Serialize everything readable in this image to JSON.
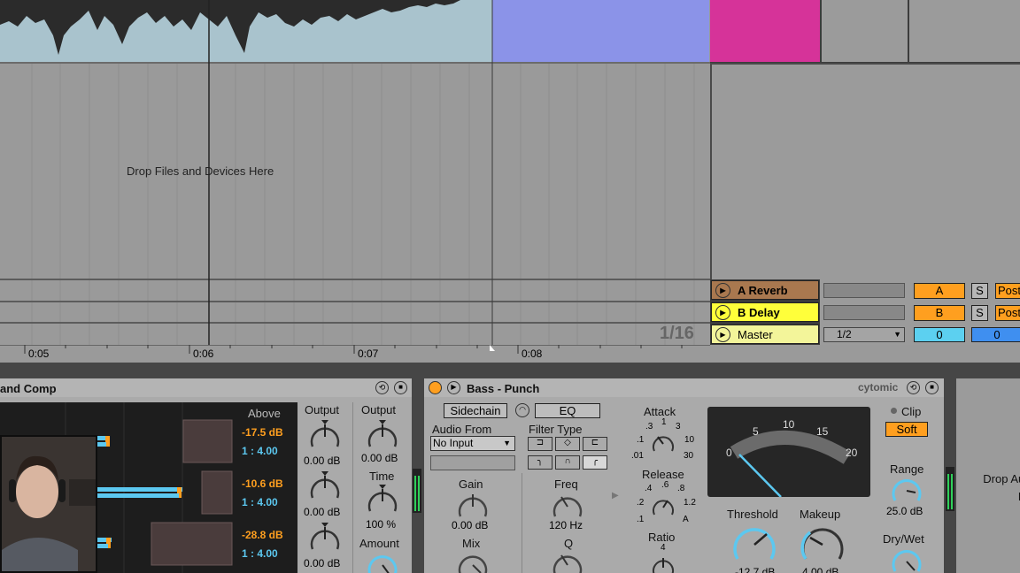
{
  "arrangement": {
    "drop_hint": "Drop Files and Devices Here",
    "quantize": "1/16",
    "timeline_ticks": [
      "0:05",
      "0:06",
      "0:07",
      "0:08"
    ]
  },
  "return_tracks": [
    {
      "name": "A Reverb",
      "color": "#a9784f",
      "tag": "A",
      "solo": "S",
      "post": "Post"
    },
    {
      "name": "B Delay",
      "color": "#ffff3a",
      "tag": "B",
      "solo": "S",
      "post": "Post"
    }
  ],
  "master": {
    "name": "Master",
    "color": "#f3f59a",
    "io": "1/2",
    "vol_a": "0",
    "vol_b": "0"
  },
  "left_device": {
    "title": "and Comp",
    "band_header": "Above",
    "bands": [
      {
        "thresh": "-17.5 dB",
        "ratio": "1 : 4.00"
      },
      {
        "thresh": "-10.6 dB",
        "ratio": "1 : 4.00"
      },
      {
        "thresh": "-28.8 dB",
        "ratio": "1 : 4.00"
      }
    ],
    "output_label": "Output",
    "output_values": [
      "0.00 dB",
      "0.00 dB",
      "0.00 dB"
    ],
    "global_output_label": "Output",
    "global_output_value": "0.00 dB",
    "time_label": "Time",
    "time_value": "100 %",
    "amount_label": "Amount"
  },
  "bus_comp": {
    "title": "Bass - Punch",
    "brand": "cytomic",
    "sidechain": "Sidechain",
    "eq": "EQ",
    "audio_from": "Audio From",
    "input": "No Input",
    "filter_type": "Filter Type",
    "gain_label": "Gain",
    "gain_value": "0.00 dB",
    "mix_label": "Mix",
    "freq_label": "Freq",
    "freq_value": "120 Hz",
    "q_label": "Q",
    "attack_label": "Attack",
    "attack_scale": [
      ".3",
      "1",
      "3",
      ".1",
      "10",
      ".01",
      "30"
    ],
    "release_label": "Release",
    "release_scale": [
      ".4",
      ".6",
      ".8",
      ".2",
      "1.2",
      ".1",
      "A"
    ],
    "ratio_label": "Ratio",
    "ratio_top": "4",
    "meter_scale": [
      "0",
      "5",
      "10",
      "15",
      "20"
    ],
    "threshold_label": "Threshold",
    "threshold_value": "-12.7 dB",
    "makeup_label": "Makeup",
    "makeup_value": "4.00 dB",
    "clip_label": "Clip",
    "soft": "Soft",
    "range_label": "Range",
    "range_value": "25.0 dB",
    "drywet_label": "Dry/Wet"
  },
  "drop_effects": "Drop Audio Effects Here",
  "colors": {
    "clip_blue": "#8b93e8",
    "clip_pink": "#d63399",
    "accent_orange": "#ff9f1f",
    "knob_blue": "#5cc8f0"
  }
}
